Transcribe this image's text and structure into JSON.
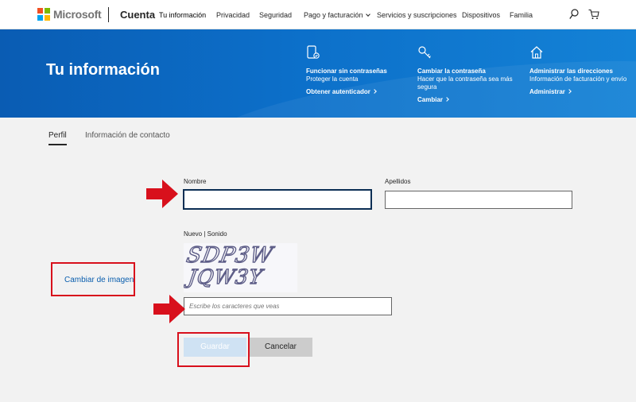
{
  "header": {
    "brand": "Microsoft",
    "section": "Cuenta",
    "nav": [
      {
        "label": "Tu información"
      },
      {
        "label": "Privacidad"
      },
      {
        "label": "Seguridad"
      },
      {
        "label": "Pago y facturación"
      },
      {
        "label": "Servicios y suscripciones"
      },
      {
        "label": "Dispositivos"
      },
      {
        "label": "Familia"
      }
    ],
    "icons": [
      "search-icon",
      "cart-icon"
    ]
  },
  "banner": {
    "title": "Tu información",
    "features": [
      {
        "icon": "passwordless-phone-icon",
        "title": "Funcionar sin contraseñas",
        "desc": "Proteger la cuenta",
        "link": "Obtener autenticador"
      },
      {
        "icon": "key-icon",
        "title": "Cambiar la contraseña",
        "desc": "Hacer que la contraseña sea más segura",
        "link": "Cambiar"
      },
      {
        "icon": "home-icon",
        "title": "Administrar las direcciones",
        "desc": "Información de facturación y envío",
        "link": "Administrar"
      }
    ]
  },
  "tabs": [
    {
      "label": "Perfil",
      "active": true
    },
    {
      "label": "Información de contacto",
      "active": false
    }
  ],
  "form": {
    "first_name_label": "Nombre",
    "first_name_value": "",
    "last_name_label": "Apellidos",
    "last_name_value": "",
    "captcha_label": "Nuevo | Sonido",
    "captcha_line1": "SDP3W",
    "captcha_line2": "JQW3Y",
    "captcha_placeholder": "Escribe los caracteres que veas",
    "change_image": "Cambiar de imagen",
    "save": "Guardar",
    "cancel": "Cancelar"
  },
  "colors": {
    "banner": "#0c6fc9",
    "link": "#0a5eae",
    "highlight": "#d8101c",
    "save_disabled": "#cfe2f3"
  }
}
